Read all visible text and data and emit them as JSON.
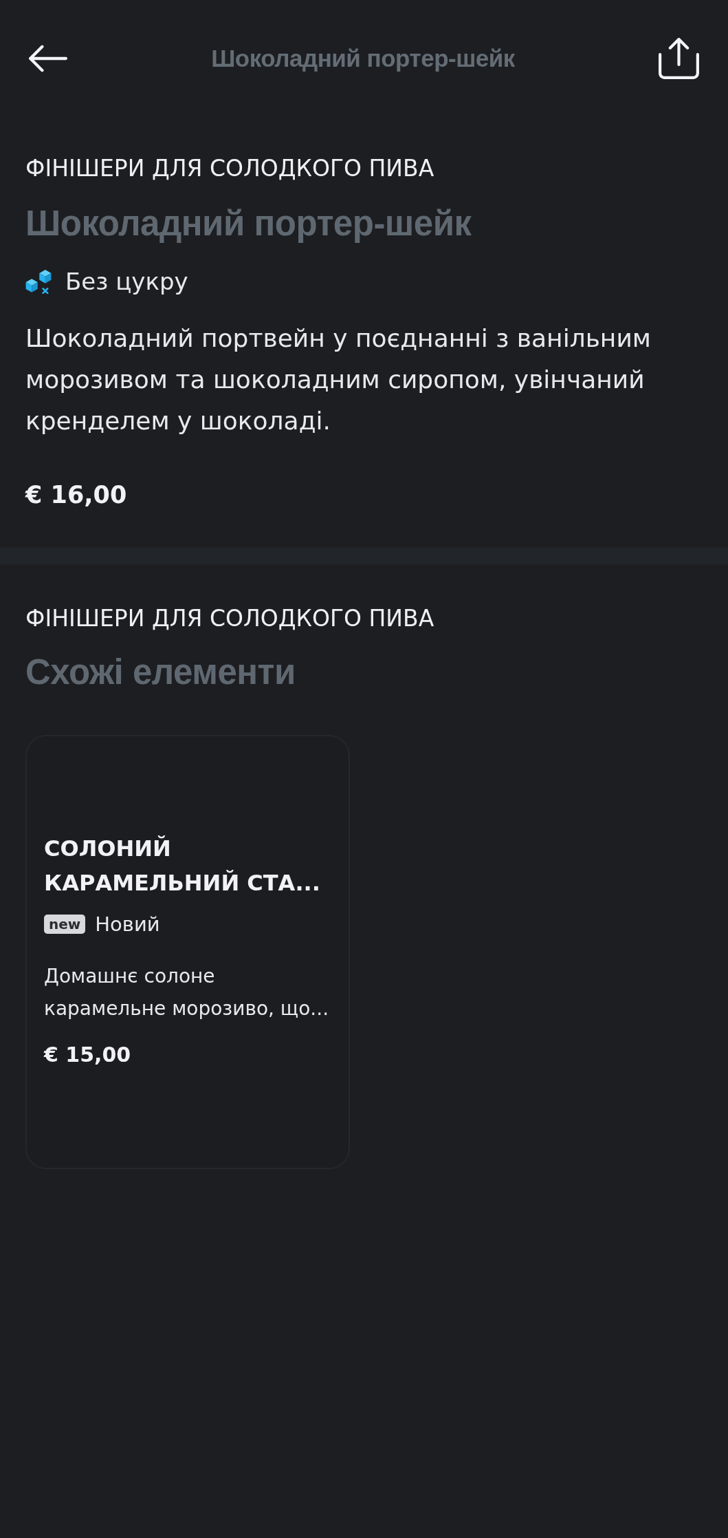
{
  "header": {
    "title": "Шоколадний портер-шейк"
  },
  "product": {
    "category": "ФІНІШЕРИ ДЛЯ СОЛОДКОГО ПИВА",
    "name": "Шоколадний портер-шейк",
    "tags": [
      {
        "kind": "sugar_free",
        "label": "Без цукру"
      }
    ],
    "description": "Шоколадний портвейн у поєднанні з ванільним морозивом та шоколадним сиропом, увінчаний кренделем у шоколаді.",
    "price": "€ 16,00"
  },
  "similar": {
    "category": "ФІНІШЕРИ ДЛЯ СОЛОДКОГО ПИВА",
    "title": "Схожі елементи",
    "items": [
      {
        "name": "СОЛОНИЙ КАРАМЕЛЬНИЙ СТА...",
        "badges": [
          {
            "kind": "new",
            "code": "new",
            "label": "Новий"
          }
        ],
        "description": "Домашнє солоне карамельне морозиво, що...",
        "price": "€ 15,00"
      }
    ]
  }
}
